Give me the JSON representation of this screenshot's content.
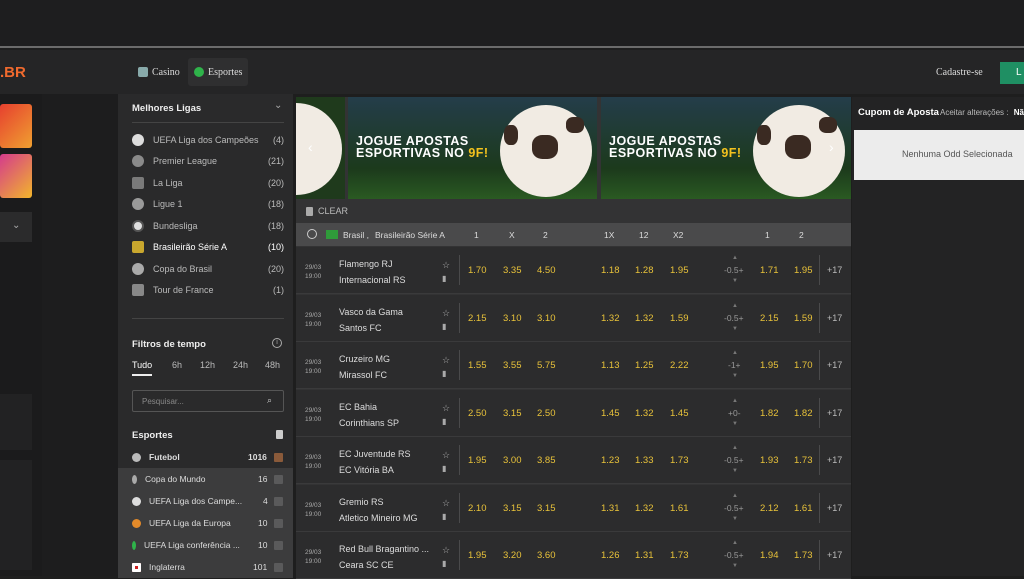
{
  "header": {
    "logo": ".BR",
    "nav": [
      {
        "label": "Casino",
        "icon": "casino-icon"
      },
      {
        "label": "Esportes",
        "icon": "soccer-ball-icon"
      }
    ],
    "register_label": "Cadastre-se",
    "login_label": "L"
  },
  "sidebar": {
    "leagues_title": "Melhores Ligas",
    "leagues": [
      {
        "name": "UEFA Liga dos Campeões",
        "count": "(4)",
        "icon": "champions-league-icon"
      },
      {
        "name": "Premier League",
        "count": "(21)",
        "icon": "premier-league-icon"
      },
      {
        "name": "La Liga",
        "count": "(20)",
        "icon": "la-liga-icon"
      },
      {
        "name": "Ligue 1",
        "count": "(18)",
        "icon": "ligue1-icon"
      },
      {
        "name": "Bundesliga",
        "count": "(18)",
        "icon": "bundesliga-icon"
      },
      {
        "name": "Brasileirão Série A",
        "count": "(10)",
        "icon": "brasileirao-icon"
      },
      {
        "name": "Copa do Brasil",
        "count": "(20)",
        "icon": "copa-brasil-icon"
      },
      {
        "name": "Tour de France",
        "count": "(1)",
        "icon": "cycling-icon"
      }
    ],
    "time_filter_title": "Filtros de tempo",
    "time_tabs": [
      "Tudo",
      "6h",
      "12h",
      "24h",
      "48h"
    ],
    "search_placeholder": "Pesquisar...",
    "sports_title": "Esportes",
    "sports": [
      {
        "name": "Futebol",
        "count": "1016"
      },
      {
        "name": "Copa do Mundo",
        "count": "16"
      },
      {
        "name": "UEFA Liga dos Campe...",
        "count": "4"
      },
      {
        "name": "UEFA Liga da Europa",
        "count": "10"
      },
      {
        "name": "UEFA Liga conferência ...",
        "count": "10"
      },
      {
        "name": "Inglaterra",
        "count": "101"
      }
    ]
  },
  "main": {
    "banner_line1": "JOGUE APOSTAS",
    "banner_line2": "ESPORTIVAS NO ",
    "banner_highlight": "9F!",
    "clear_label": "CLEAR",
    "header": {
      "country": "Brasil ,",
      "league": "Brasileirão Série A",
      "cols": [
        "1",
        "X",
        "2",
        "1X",
        "12",
        "X2",
        "1",
        "2"
      ]
    },
    "matches": [
      {
        "date": "29/03",
        "time": "19:00",
        "home": "Flamengo RJ",
        "away": "Internacional RS",
        "odds": [
          "1.70",
          "3.35",
          "4.50",
          "1.18",
          "1.28",
          "1.95"
        ],
        "handicap": "-0.5+",
        "h_odds": [
          "1.71",
          "1.95"
        ],
        "more": "+17"
      },
      {
        "date": "29/03",
        "time": "19:00",
        "home": "Vasco da Gama",
        "away": "Santos FC",
        "odds": [
          "2.15",
          "3.10",
          "3.10",
          "1.32",
          "1.32",
          "1.59"
        ],
        "handicap": "-0.5+",
        "h_odds": [
          "2.15",
          "1.59"
        ],
        "more": "+17"
      },
      {
        "date": "29/03",
        "time": "19:00",
        "home": "Cruzeiro MG",
        "away": "Mirassol FC",
        "odds": [
          "1.55",
          "3.55",
          "5.75",
          "1.13",
          "1.25",
          "2.22"
        ],
        "handicap": "-1+",
        "h_odds": [
          "1.95",
          "1.70"
        ],
        "more": "+17"
      },
      {
        "date": "29/03",
        "time": "19:00",
        "home": "EC Bahia",
        "away": "Corinthians SP",
        "odds": [
          "2.50",
          "3.15",
          "2.50",
          "1.45",
          "1.32",
          "1.45"
        ],
        "handicap": "+0-",
        "h_odds": [
          "1.82",
          "1.82"
        ],
        "more": "+17"
      },
      {
        "date": "29/03",
        "time": "19:00",
        "home": "EC Juventude RS",
        "away": "EC Vitória BA",
        "odds": [
          "1.95",
          "3.00",
          "3.85",
          "1.23",
          "1.33",
          "1.73"
        ],
        "handicap": "-0.5+",
        "h_odds": [
          "1.93",
          "1.73"
        ],
        "more": "+17"
      },
      {
        "date": "29/03",
        "time": "19:00",
        "home": "Gremio RS",
        "away": "Atletico Mineiro MG",
        "odds": [
          "2.10",
          "3.15",
          "3.15",
          "1.31",
          "1.32",
          "1.61"
        ],
        "handicap": "-0.5+",
        "h_odds": [
          "2.12",
          "1.61"
        ],
        "more": "+17"
      },
      {
        "date": "29/03",
        "time": "19:00",
        "home": "Red Bull Bragantino ...",
        "away": "Ceara SC CE",
        "odds": [
          "1.95",
          "3.20",
          "3.60",
          "1.26",
          "1.31",
          "1.73"
        ],
        "handicap": "-0.5+",
        "h_odds": [
          "1.94",
          "1.73"
        ],
        "more": "+17"
      }
    ]
  },
  "coupon": {
    "title": "Cupom de Aposta",
    "accept_label": "Aceitar alterações :",
    "accept_value": "Não",
    "empty_text": "Nenhuma Odd Selecionada"
  }
}
